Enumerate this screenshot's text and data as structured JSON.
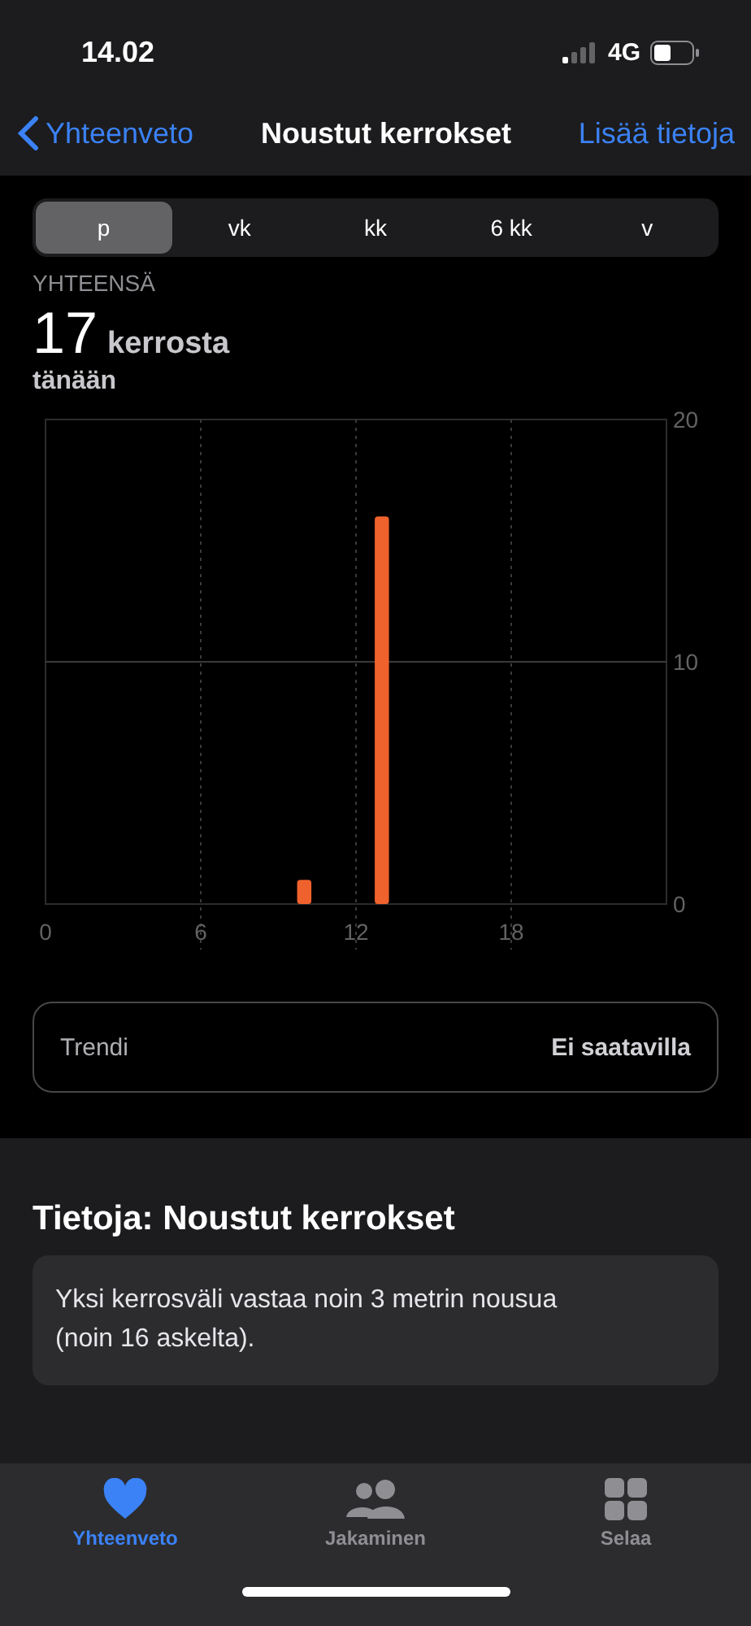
{
  "status_bar": {
    "time": "14.02",
    "network": "4G"
  },
  "nav": {
    "back": "Yhteenveto",
    "title": "Noustut kerrokset",
    "action": "Lisää tietoja"
  },
  "segments": [
    {
      "label": "p",
      "selected": true
    },
    {
      "label": "vk",
      "selected": false
    },
    {
      "label": "kk",
      "selected": false
    },
    {
      "label": "6 kk",
      "selected": false
    },
    {
      "label": "v",
      "selected": false
    }
  ],
  "summary": {
    "caption": "YHTEENSÄ",
    "value": "17",
    "unit": "kerrosta",
    "period": "tänään"
  },
  "chart": {
    "chart_data": {
      "type": "bar",
      "x": [
        0,
        1,
        2,
        3,
        4,
        5,
        6,
        7,
        8,
        9,
        10,
        11,
        12,
        13,
        14,
        15,
        16,
        17,
        18,
        19,
        20,
        21,
        22,
        23
      ],
      "series": [
        {
          "color": "#f0622d",
          "values": [
            0,
            0,
            0,
            0,
            0,
            0,
            0,
            0,
            0,
            0,
            1,
            0,
            0,
            16,
            0,
            0,
            0,
            0,
            0,
            0,
            0,
            0,
            0,
            0
          ]
        }
      ],
      "xticks": [
        0,
        6,
        12,
        18
      ],
      "xlim": [
        0,
        24
      ],
      "grid": true,
      "ref_lines": [
        {
          "axis": "y",
          "value": 10
        }
      ],
      "yticks": [
        0,
        10,
        20
      ],
      "ylim": [
        0,
        20
      ]
    }
  },
  "trend": {
    "label": "Trendi",
    "value": "Ei saatavilla"
  },
  "about": {
    "title": "Tietoja: Noustut kerrokset",
    "text": "Yksi kerrosväli vastaa noin 3 metrin nousua (noin 16 askelta)."
  },
  "tab_bar": [
    {
      "label": "Yhteenveto",
      "kind": "heart",
      "selected": true
    },
    {
      "label": "Jakaminen",
      "kind": "people",
      "selected": false
    },
    {
      "label": "Selaa",
      "kind": "grid",
      "selected": false
    }
  ]
}
